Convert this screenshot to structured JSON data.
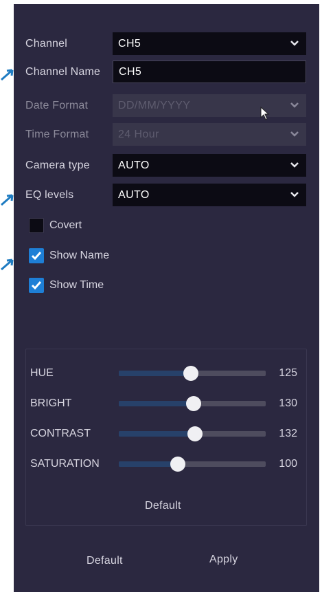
{
  "form": {
    "channel": {
      "label": "Channel",
      "value": "CH5"
    },
    "channel_name": {
      "label": "Channel Name",
      "value": "CH5"
    },
    "date_format": {
      "label": "Date Format",
      "value": "DD/MM/YYYY"
    },
    "time_format": {
      "label": "Time Format",
      "value": "24 Hour"
    },
    "camera_type": {
      "label": "Camera type",
      "value": "AUTO"
    },
    "eq_levels": {
      "label": "EQ levels",
      "value": "AUTO"
    }
  },
  "checkboxes": [
    {
      "label": "Covert",
      "checked": false
    },
    {
      "label": "Show Name",
      "checked": true
    },
    {
      "label": "Show Time",
      "checked": true
    }
  ],
  "image": {
    "sliders": [
      {
        "label": "HUE",
        "value": "125",
        "fraction": 0.49
      },
      {
        "label": "BRIGHT",
        "value": "130",
        "fraction": 0.51
      },
      {
        "label": "CONTRAST",
        "value": "132",
        "fraction": 0.52
      },
      {
        "label": "SATURATION",
        "value": "100",
        "fraction": 0.4
      }
    ],
    "default_label": "Default"
  },
  "footer": {
    "default_label": "Default",
    "apply_label": "Apply"
  },
  "colors": {
    "panel": "#2b2840",
    "checkbox_on": "#1e7fd6",
    "arrow": "#1f7cc2"
  }
}
